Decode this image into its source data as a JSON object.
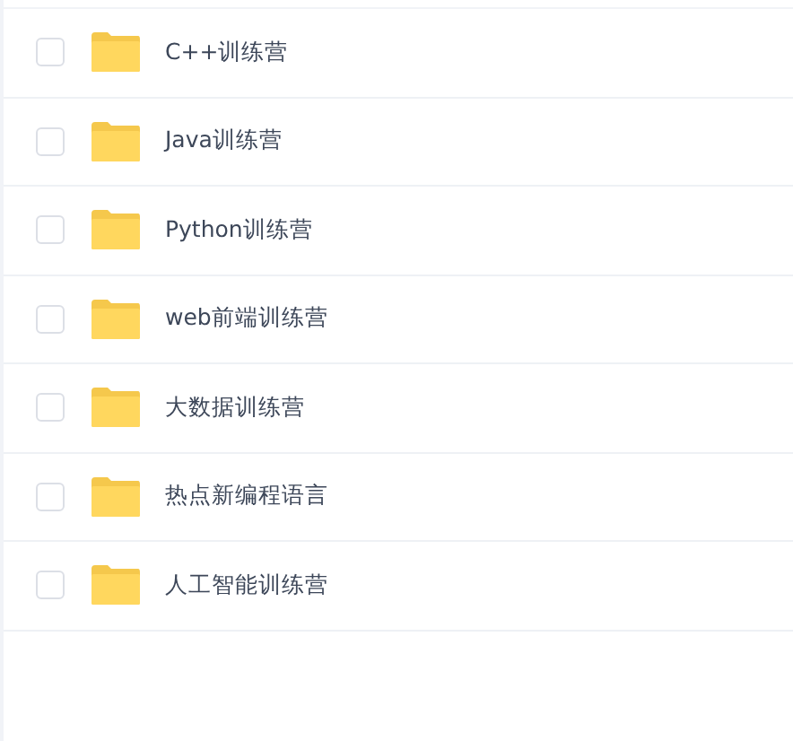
{
  "folders": [
    {
      "name": "C++训练营",
      "checked": false
    },
    {
      "name": "Java训练营",
      "checked": false
    },
    {
      "name": "Python训练营",
      "checked": false
    },
    {
      "name": "web前端训练营",
      "checked": false
    },
    {
      "name": "大数据训练营",
      "checked": false
    },
    {
      "name": "热点新编程语言",
      "checked": false
    },
    {
      "name": "人工智能训练营",
      "checked": false
    }
  ]
}
